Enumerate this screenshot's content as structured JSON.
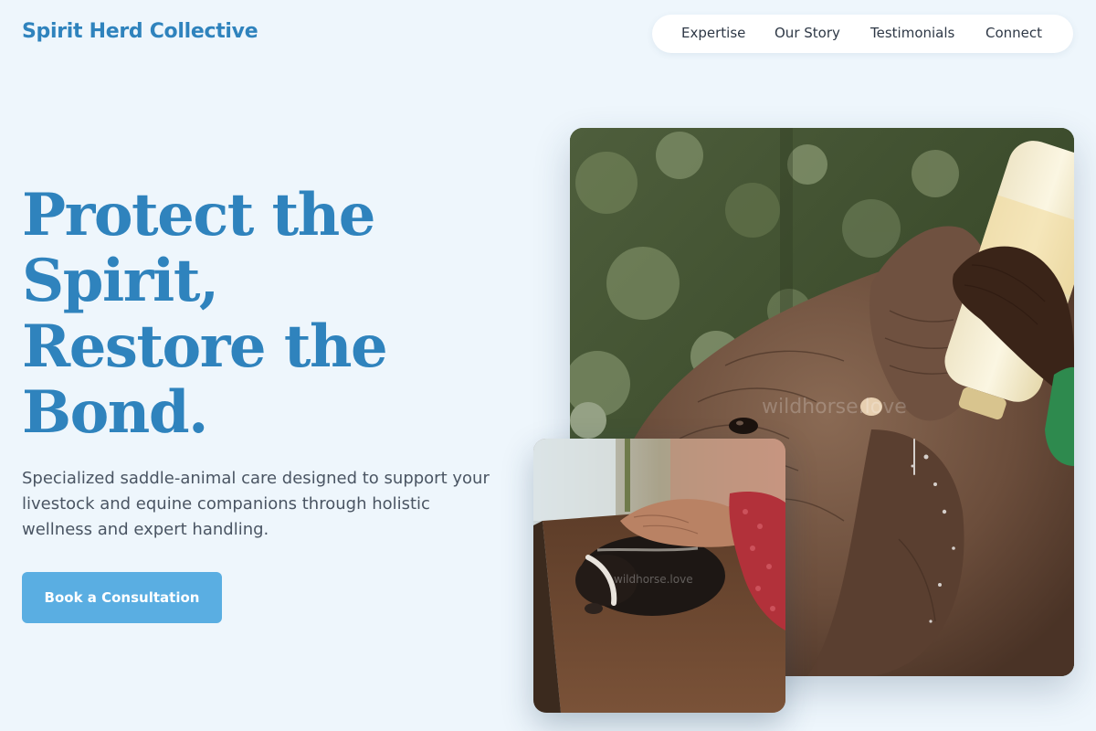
{
  "brand": {
    "name": "Spirit Herd Collective"
  },
  "nav": {
    "items": [
      {
        "label": "Expertise"
      },
      {
        "label": "Our Story"
      },
      {
        "label": "Testimonials"
      },
      {
        "label": "Connect"
      }
    ]
  },
  "hero": {
    "headline_lines": [
      "Protect the",
      "Spirit,",
      "Restore the",
      "Bond."
    ],
    "subtext": "Specialized saddle-animal care designed to support your livestock and equine companions through holistic wellness and expert handling.",
    "cta_label": "Book a Consultation"
  },
  "images": {
    "main_watermark": "wildhorse.love",
    "small_watermark": "wildhorse.love"
  },
  "colors": {
    "accent": "#2f83bd",
    "button": "#5aaee2",
    "background": "#eef6fc",
    "body_text": "#4a5563"
  }
}
